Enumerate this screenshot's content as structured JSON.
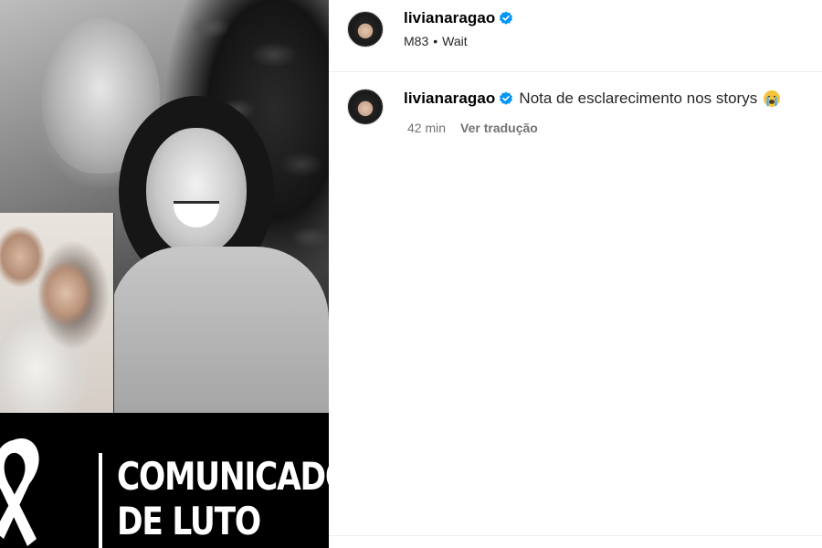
{
  "post": {
    "username": "livianaragao",
    "subtitle_left": "M83",
    "subtitle_separator": "•",
    "subtitle_right": "Wait"
  },
  "caption": {
    "username": "livianaragao",
    "text": "Nota de esclarecimento nos storys",
    "emoji": "crying-face-emoji",
    "time": "42 min",
    "see_translation": "Ver tradução"
  },
  "media": {
    "banner_line_1": "COMUNICADO",
    "banner_line_2": "DE LUTO"
  },
  "colors": {
    "verified_blue": "#0095f6",
    "meta_gray": "#737373",
    "divider": "#efefef"
  }
}
